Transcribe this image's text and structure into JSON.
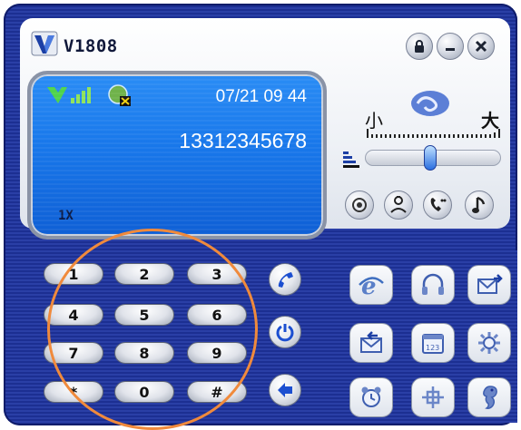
{
  "app": {
    "device_name": "V1808"
  },
  "screen": {
    "datetime": "07/21 09 44",
    "number": "13312345678",
    "network_mode": "1X"
  },
  "volume": {
    "small_label": "小",
    "large_label": "大",
    "level_fraction": 0.48
  },
  "keypad": {
    "keys": [
      "1",
      "2",
      "3",
      "4",
      "5",
      "6",
      "7",
      "8",
      "9",
      "*",
      "0",
      "#"
    ]
  },
  "icons": {
    "window": [
      "lock-icon",
      "minimize-icon",
      "close-icon"
    ],
    "tools": [
      "camera-icon",
      "contacts-icon",
      "voicemail-icon",
      "music-note-icon"
    ],
    "side": [
      "call-icon",
      "power-icon",
      "back-icon"
    ],
    "apps": [
      "browser-icon",
      "headset-icon",
      "send-message-icon",
      "inbox-icon",
      "calendar-icon",
      "settings-icon",
      "alarm-clock-icon",
      "knot-icon",
      "seahorse-icon"
    ]
  },
  "colors": {
    "frame": "#1c2f92",
    "screen": "#1877ea",
    "annotation": "#f08a3c"
  }
}
